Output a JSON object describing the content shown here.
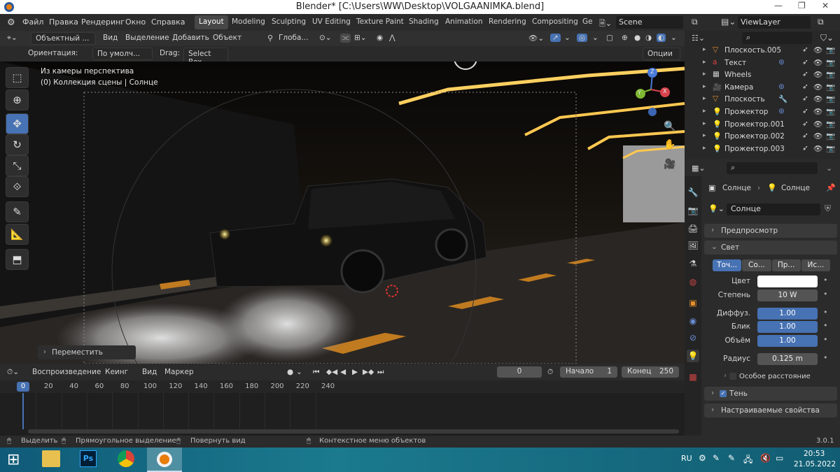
{
  "window": {
    "title": "Blender* [C:\\Users\\WW\\Desktop\\VOLGAANIMKA.blend]"
  },
  "menu": [
    "Файл",
    "Правка",
    "Рендеринг",
    "Окно",
    "Справка"
  ],
  "workspaces": [
    "Layout",
    "Modeling",
    "Sculpting",
    "UV Editing",
    "Texture Paint",
    "Shading",
    "Animation",
    "Rendering",
    "Compositing",
    "Ge"
  ],
  "scene": {
    "name": "Scene",
    "view_layer": "ViewLayer"
  },
  "viewport_header": {
    "mode": "Объектный ...",
    "items": [
      "Вид",
      "Выделение",
      "Добавить",
      "Объект"
    ],
    "transform": "Глоба..."
  },
  "tool_settings": {
    "orientation_label": "Ориентация:",
    "orientation_value": "По умолч...",
    "drag_label": "Drag:",
    "drag_value": "Select Box",
    "options": "Опции"
  },
  "viewport": {
    "line1": "Из камеры перспектива",
    "line2": "(0) Коллекция сцены | Солнце",
    "last_op": "Переместить",
    "gizmo_axes": [
      "Z",
      "Y",
      "X"
    ]
  },
  "outliner": {
    "rows": [
      {
        "name": "Плоскость.005"
      },
      {
        "name": "Текст"
      },
      {
        "name": "Wheels"
      },
      {
        "name": "Камера"
      },
      {
        "name": "Плоскость"
      },
      {
        "name": "Прожектор"
      },
      {
        "name": "Прожектор.001"
      },
      {
        "name": "Прожектор.002"
      },
      {
        "name": "Прожектор.003"
      }
    ]
  },
  "properties": {
    "breadcrumb_object": "Солнце",
    "breadcrumb_data": "Солнце",
    "datablock": "Солнце",
    "preview_panel": "Предпросмотр",
    "light_panel": "Свет",
    "light_types": [
      "Точ...",
      "Со...",
      "Пр...",
      "Ис..."
    ],
    "color_label": "Цвет",
    "color_value": "#ffffff",
    "power_label": "Степень",
    "power_value": "10 W",
    "diffuse_label": "Диффуз.",
    "diffuse_value": "1.00",
    "specular_label": "Блик",
    "specular_value": "1.00",
    "volume_label": "Объём",
    "volume_value": "1.00",
    "radius_label": "Радиус",
    "radius_value": "0.125 m",
    "custom_distance": "Особое расстояние",
    "shadow_panel": "Тень",
    "custom_props_panel": "Настраиваемые свойства"
  },
  "timeline": {
    "menu": [
      "Воспроизведение",
      "Кеинг",
      "Вид",
      "Маркер"
    ],
    "current_frame": "0",
    "start_label": "Начало",
    "start_value": "1",
    "end_label": "Конец",
    "end_value": "250",
    "ticks": [
      "0",
      "20",
      "40",
      "60",
      "80",
      "100",
      "120",
      "140",
      "160",
      "180",
      "200",
      "220",
      "240"
    ]
  },
  "statusbar": {
    "select": "Выделить",
    "box_select": "Прямоугольное выделение",
    "rotate_view": "Повернуть вид",
    "context_menu": "Контекстное меню объектов",
    "version": "3.0.1"
  },
  "taskbar": {
    "lang": "RU",
    "time": "20:53",
    "date": "21.05.2022"
  }
}
